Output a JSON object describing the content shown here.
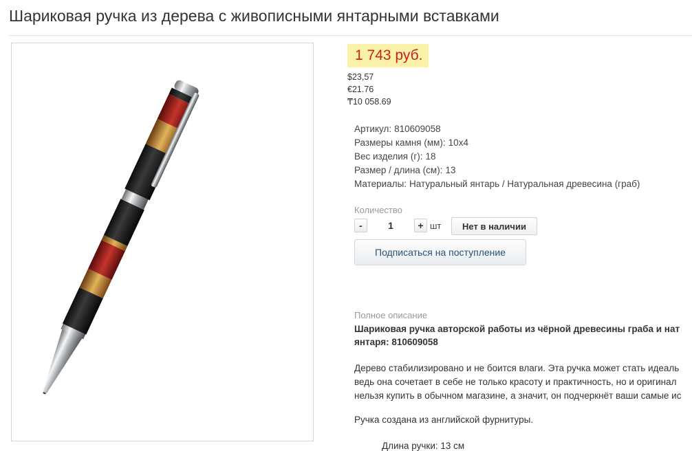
{
  "product": {
    "title": "Шариковая ручка из дерева с живописными янтарными вставками"
  },
  "price": {
    "main": "1 743 руб.",
    "alternates": [
      "$23,57",
      "€21.76",
      "₸10 058.69"
    ]
  },
  "specs": [
    {
      "label": "Артикул:",
      "value": "810609058"
    },
    {
      "label": "Размеры камня (мм):",
      "value": "10x4"
    },
    {
      "label": "Вес изделия (г):",
      "value": "18"
    },
    {
      "label": "Размер / длина (см):",
      "value": "13"
    },
    {
      "label": "Материалы:",
      "value": "Натуральный янтарь / Натуральная древесина (граб)"
    }
  ],
  "purchase": {
    "quantity_label": "Количество",
    "minus": "-",
    "plus": "+",
    "quantity": "1",
    "unit": "шт",
    "stock_button": "Нет в наличии",
    "subscribe_button": "Подписаться на поступление"
  },
  "description": {
    "label": "Полное описание",
    "heading_lines": [
      "Шариковая ручка авторской работы из чёрной древесины граба и нат",
      "янтаря: 810609058"
    ],
    "paragraph1_lines": [
      "Дерево стабилизировано и не боится влаги. Эта ручка может стать идеаль",
      "ведь она сочетает в себе не только красоту и практичность, но и оригинал",
      "нельзя купить в обычном магазине, а значит, он подчеркнёт ваши самые ис"
    ],
    "paragraph2": "Ручка создана из английской фурнитуры.",
    "partial_line": "Длина ручки: 13 см"
  },
  "colors": {
    "price_bg": "#fbf2a9",
    "price_text": "#c8211e",
    "link_text": "#2a4f75"
  }
}
